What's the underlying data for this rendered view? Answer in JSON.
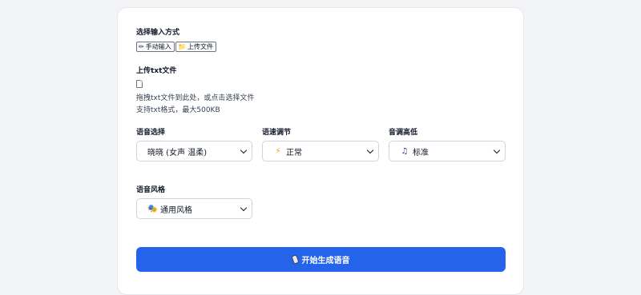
{
  "input_mode": {
    "title": "选择输入方式",
    "options": [
      {
        "icon": "pencil-icon",
        "label": "手动输入"
      },
      {
        "icon": "folder-icon",
        "label": "上传文件"
      }
    ]
  },
  "upload": {
    "title": "上传txt文件",
    "hint_line1": "拖拽txt文件到此处，或点击选择文件",
    "hint_line2": "支持txt格式，最大500KB"
  },
  "voice": {
    "label": "语音选择",
    "selected": "晓晓 (女声 温柔)"
  },
  "speed": {
    "label": "语速调节",
    "icon": "lightning-icon",
    "selected": "正常"
  },
  "pitch": {
    "label": "音调高低",
    "icon": "music-note-icon",
    "selected": "标准"
  },
  "style": {
    "label": "语音风格",
    "icon": "theater-masks-icon",
    "selected": "通用风格"
  },
  "submit": {
    "icon": "microphone-icon",
    "label": "开始生成语音"
  },
  "colors": {
    "accent": "#2563eb",
    "background": "#f3f4f6",
    "card": "#ffffff"
  }
}
